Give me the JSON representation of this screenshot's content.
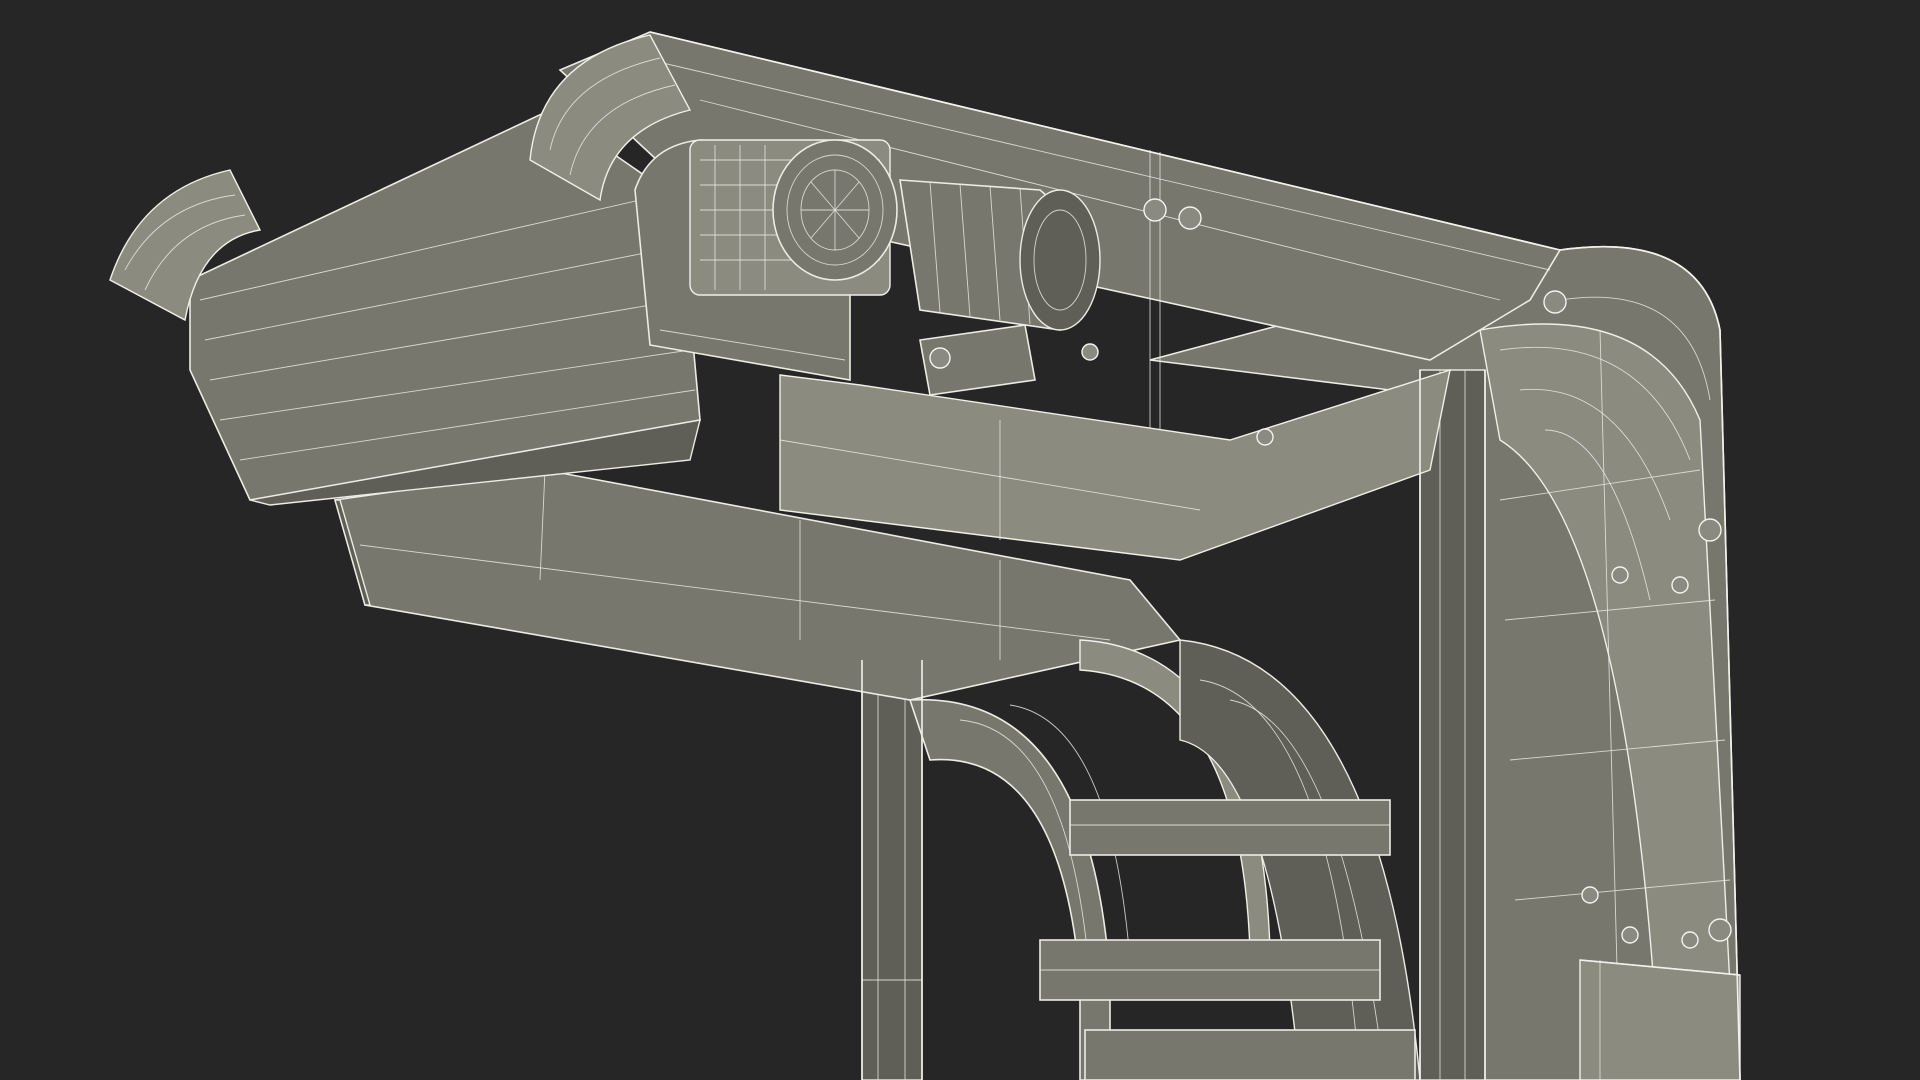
{
  "scene": {
    "background_color": "#262626",
    "mesh_fill_color": "#77776d",
    "wire_color": "#f2f2ec"
  }
}
